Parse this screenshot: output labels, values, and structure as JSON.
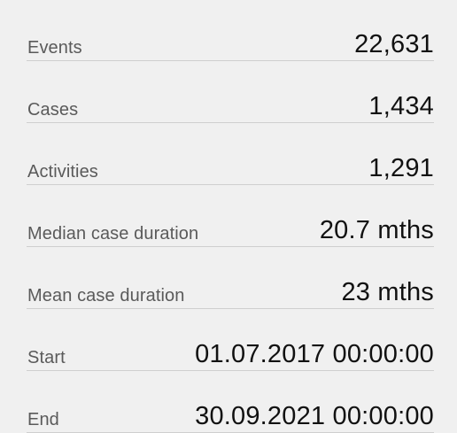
{
  "stats": [
    {
      "label": "Events",
      "value": "22,631"
    },
    {
      "label": "Cases",
      "value": "1,434"
    },
    {
      "label": "Activities",
      "value": "1,291"
    },
    {
      "label": "Median case duration",
      "value": "20.7 mths"
    },
    {
      "label": "Mean case duration",
      "value": "23 mths"
    },
    {
      "label": "Start",
      "value": "01.07.2017 00:00:00"
    },
    {
      "label": "End",
      "value": "30.09.2021 00:00:00"
    }
  ]
}
